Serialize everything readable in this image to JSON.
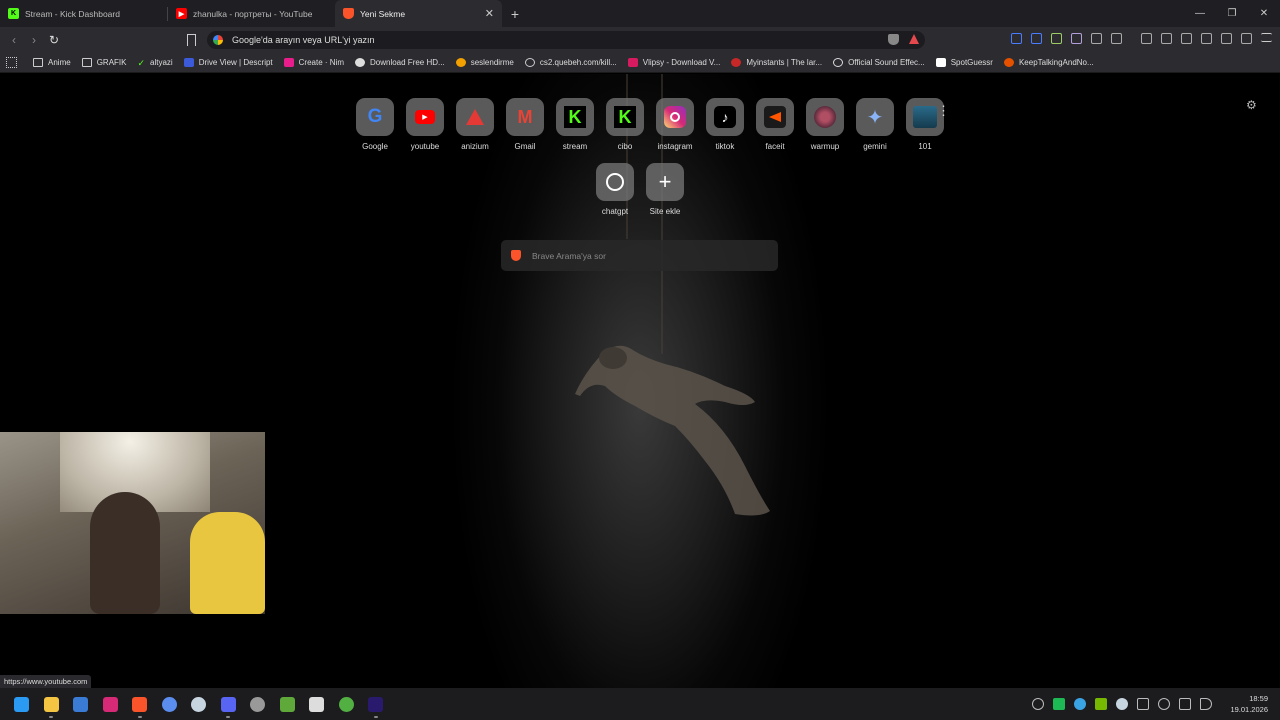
{
  "tabs": [
    {
      "title": "Stream - Kick Dashboard",
      "favicon": "kick-icon",
      "color": "#53fc18",
      "active": false
    },
    {
      "title": "zhanulka - портреты - YouTube",
      "favicon": "youtube-icon",
      "color": "#ff0000",
      "active": false
    },
    {
      "title": "Yeni Sekme",
      "favicon": "brave-icon",
      "color": "#fb542b",
      "active": true
    }
  ],
  "new_tab_label": "+",
  "address_bar": {
    "placeholder": "Google'da arayın veya URL'yi yazın"
  },
  "bookmarks": [
    {
      "label": "Anime",
      "icon": "folder-icon"
    },
    {
      "label": "GRAFIK",
      "icon": "folder-icon"
    },
    {
      "label": "altyazi",
      "icon": "check-icon",
      "color": "#53fc18"
    },
    {
      "label": "Drive View | Descript",
      "icon": "descript-icon",
      "color": "#3b5bdb"
    },
    {
      "label": "Create · Nim",
      "icon": "nim-icon",
      "color": "#e91e8c"
    },
    {
      "label": "Download Free HD...",
      "icon": "clip-icon",
      "color": "#dddddd"
    },
    {
      "label": "seslendirme",
      "icon": "voice-icon",
      "color": "#f2a100"
    },
    {
      "label": "cs2.quebeh.com/kill...",
      "icon": "globe-icon",
      "color": "#cccccc"
    },
    {
      "label": "Vlipsy - Download V...",
      "icon": "vlipsy-icon",
      "color": "#d81b60"
    },
    {
      "label": "Myinstants | The lar...",
      "icon": "myinstants-icon",
      "color": "#c62828"
    },
    {
      "label": "Official Sound Effec...",
      "icon": "sound-icon",
      "color": "#dddddd"
    },
    {
      "label": "SpotGuessr",
      "icon": "spotguessr-icon",
      "color": "#ffffff"
    },
    {
      "label": "KeepTalkingAndNo...",
      "icon": "ktane-icon",
      "color": "#e65100"
    }
  ],
  "shortcuts_row1": [
    {
      "label": "Google",
      "icon": "google-icon",
      "color": "#4285f4"
    },
    {
      "label": "youtube",
      "icon": "youtube-icon",
      "color": "#ff0000"
    },
    {
      "label": "anizium",
      "icon": "anizium-icon",
      "color": "#e53935"
    },
    {
      "label": "Gmail",
      "icon": "gmail-icon",
      "color": "#ea4335"
    },
    {
      "label": "stream",
      "icon": "kick-icon",
      "color": "#53fc18"
    },
    {
      "label": "cibo",
      "icon": "kick-icon",
      "color": "#53fc18"
    },
    {
      "label": "instagram",
      "icon": "instagram-icon",
      "color": "#d62976"
    },
    {
      "label": "tiktok",
      "icon": "tiktok-icon",
      "color": "#000000"
    },
    {
      "label": "faceit",
      "icon": "faceit-icon",
      "color": "#ff5500"
    },
    {
      "label": "warmup",
      "icon": "warmup-icon",
      "color": "#8e3b4f"
    },
    {
      "label": "gemini",
      "icon": "gemini-icon",
      "color": "#8ab4f8"
    },
    {
      "label": "101",
      "icon": "101-icon",
      "color": "#2a6b8a"
    }
  ],
  "shortcuts_row2": [
    {
      "label": "chatgpt",
      "icon": "chatgpt-icon",
      "color": "#ffffff"
    },
    {
      "label": "Site ekle",
      "icon": "plus-icon",
      "color": "#ffffff"
    }
  ],
  "search_box": {
    "placeholder": "Brave Arama'ya sor"
  },
  "status_url": "https://www.youtube.com",
  "taskbar_apps": [
    {
      "name": "windows-start-icon",
      "color": "#2b9af3"
    },
    {
      "name": "file-explorer-icon",
      "color": "#f4c542"
    },
    {
      "name": "widgets-icon",
      "color": "#3a7bd5"
    },
    {
      "name": "instagram-icon",
      "color": "#d62976"
    },
    {
      "name": "brave-icon",
      "color": "#fb542b"
    },
    {
      "name": "app-blue-icon",
      "color": "#5b8def"
    },
    {
      "name": "steam-icon",
      "color": "#c7d5e0"
    },
    {
      "name": "discord-icon",
      "color": "#5865f2"
    },
    {
      "name": "app-badge-icon",
      "color": "#999999"
    },
    {
      "name": "minecraft-icon",
      "color": "#5fa83a"
    },
    {
      "name": "epic-games-icon",
      "color": "#dddddd"
    },
    {
      "name": "xbox-icon",
      "color": "#52b043"
    },
    {
      "name": "premiere-pro-icon",
      "color": "#2a1a6e"
    }
  ],
  "tray_icons": [
    {
      "name": "tray-app-icon",
      "color": "#bbbbbb"
    },
    {
      "name": "tray-green-icon",
      "color": "#1db954"
    },
    {
      "name": "tray-edge-icon",
      "color": "#3aa3e3"
    },
    {
      "name": "nvidia-icon",
      "color": "#76b900"
    },
    {
      "name": "tray-steam-icon",
      "color": "#c7d5e0"
    },
    {
      "name": "usb-icon",
      "color": "#bbbbbb"
    },
    {
      "name": "microphone-icon",
      "color": "#bbbbbb"
    },
    {
      "name": "network-icon",
      "color": "#bbbbbb"
    },
    {
      "name": "volume-icon",
      "color": "#bbbbbb"
    }
  ],
  "clock": {
    "time": "18:59",
    "date": "19.01.2026"
  }
}
